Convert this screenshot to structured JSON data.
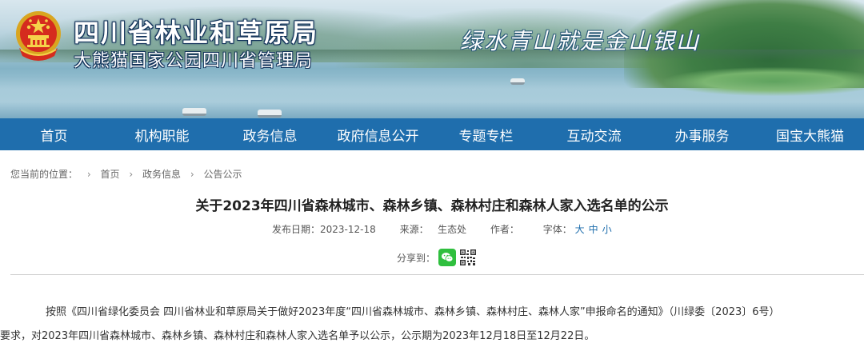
{
  "header": {
    "site_title": "四川省林业和草原局",
    "site_subtitle": "大熊猫国家公园四川省管理局",
    "slogan": "绿水青山就是金山银山",
    "emblem_icon": "national-emblem-icon"
  },
  "nav": {
    "items": [
      {
        "label": "首页"
      },
      {
        "label": "机构职能"
      },
      {
        "label": "政务信息"
      },
      {
        "label": "政府信息公开"
      },
      {
        "label": "专题专栏"
      },
      {
        "label": "互动交流"
      },
      {
        "label": "办事服务"
      },
      {
        "label": "国宝大熊猫"
      }
    ],
    "bg_color": "#1f6ead"
  },
  "breadcrumb": {
    "prefix": "您当前的位置：",
    "items": [
      "首页",
      "政务信息",
      "公告公示"
    ],
    "separator": "›"
  },
  "article": {
    "title": "关于2023年四川省森林城市、森林乡镇、森林村庄和森林人家入选名单的公示",
    "publish_date_label": "发布日期：",
    "publish_date": "2023-12-18",
    "source_label": "来源：",
    "source": "生态处",
    "author_label": "作者：",
    "author": "",
    "font_label": "字体：",
    "font_options": [
      "大",
      "中",
      "小"
    ],
    "share_label": "分享到：",
    "share_icons": [
      "wechat-icon",
      "qr-code-icon"
    ],
    "paragraph_line1": "按照《四川省绿化委员会 四川省林业和草原局关于做好2023年度“四川省森林城市、森林乡镇、森林村庄、森林人家”申报命名的通知》（川绿委〔2023〕6号）",
    "paragraph_line2": "要求，对2023年四川省森林城市、森林乡镇、森林村庄和森林人家入选名单予以公示，公示期为2023年12月18日至12月22日。"
  }
}
